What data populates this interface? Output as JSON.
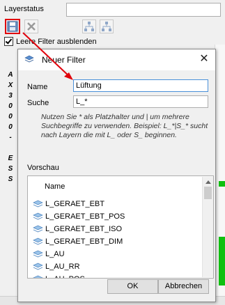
{
  "background": {
    "layerstatus_label": "Layerstatus",
    "checkbox_label": "Leere Filter ausblenden",
    "side_letters": [
      "A",
      "X",
      "3",
      "0",
      "0",
      "0",
      "-",
      "E",
      "S",
      "S"
    ]
  },
  "dialog": {
    "title": "Neuer Filter",
    "name_label": "Name",
    "name_value": "Lüftung",
    "search_label": "Suche",
    "search_value": "L_*",
    "hint": "Nutzen Sie * als Platzhalter und | um mehrere Suchbegriffe zu verwenden. Beispiel: L_*|S_* sucht nach Layern die mit L_ oder S_ beginnen.",
    "preview_label": "Vorschau",
    "list_header": "Name",
    "items": [
      "L_GERAET_EBT",
      "L_GERAET_EBT_POS",
      "L_GERAET_EBT_ISO",
      "L_GERAET_EBT_DIM",
      "L_AU",
      "L_AU_RR",
      "L_AU_POS"
    ],
    "ok_label": "OK",
    "cancel_label": "Abbrechen"
  },
  "colors": {
    "highlight": "#e0000b",
    "focus_border": "#4a90d9",
    "accent_green": "#10c010"
  }
}
